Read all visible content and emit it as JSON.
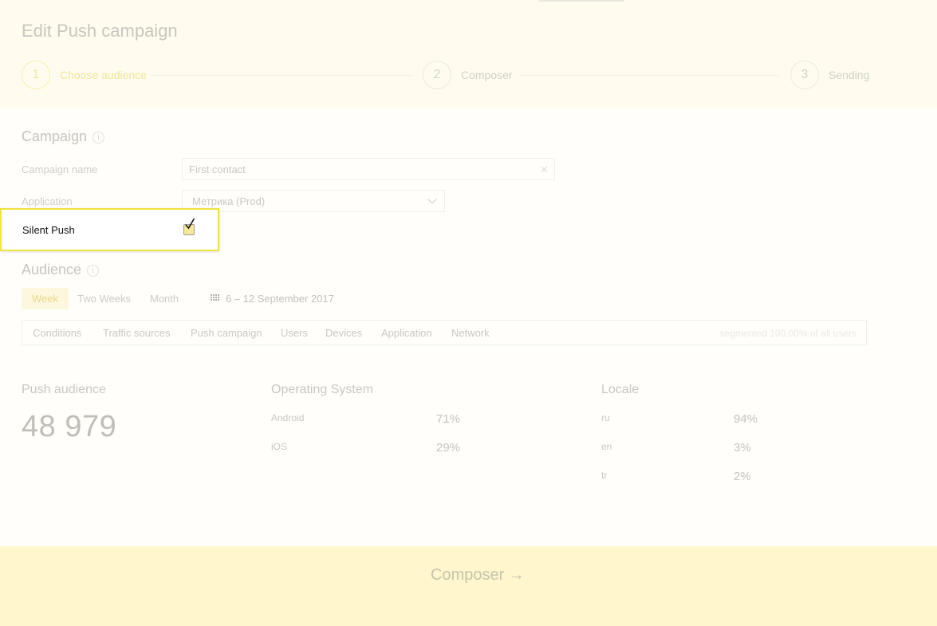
{
  "page": {
    "title": "Edit Push campaign"
  },
  "steps": [
    {
      "number": "1",
      "label": "Choose audience"
    },
    {
      "number": "2",
      "label": "Composer"
    },
    {
      "number": "3",
      "label": "Sending"
    }
  ],
  "campaign": {
    "section_title": "Campaign",
    "info_glyph": "i",
    "name_label": "Campaign name",
    "name_value": "First contact",
    "clear_glyph": "✕",
    "application_label": "Application",
    "application_value": "Метрика (Prod)",
    "silent_push_label": "Silent Push",
    "silent_push_checked": true
  },
  "audience": {
    "section_title": "Audience",
    "info_glyph": "i",
    "periods": [
      "Week",
      "Two Weeks",
      "Month"
    ],
    "active_period": "Week",
    "date_range": "6 – 12 September 2017",
    "filters": [
      "Conditions",
      "Traffic sources",
      "Push campaign",
      "Users",
      "Devices",
      "Application",
      "Network"
    ],
    "segmented_text": "segmented 100.00% of all users"
  },
  "stats": {
    "push_audience": {
      "title": "Push audience",
      "value": "48 979"
    },
    "os": {
      "title": "Operating System",
      "rows": [
        {
          "label": "Android",
          "value": "71%"
        },
        {
          "label": "iOS",
          "value": "29%"
        }
      ]
    },
    "locale": {
      "title": "Locale",
      "rows": [
        {
          "label": "ru",
          "value": "94%"
        },
        {
          "label": "en",
          "value": "3%"
        },
        {
          "label": "tr",
          "value": "2%"
        }
      ]
    }
  },
  "footer": {
    "button_label": "Composer →"
  },
  "colors": {
    "highlight_border": "#efe33d",
    "footer_bg": "#fff6cd",
    "active_step": "#f0e49a"
  },
  "icons": [
    "info-icon",
    "clear-icon",
    "chevron-down-icon",
    "calendar-icon",
    "checkmark-icon"
  ]
}
